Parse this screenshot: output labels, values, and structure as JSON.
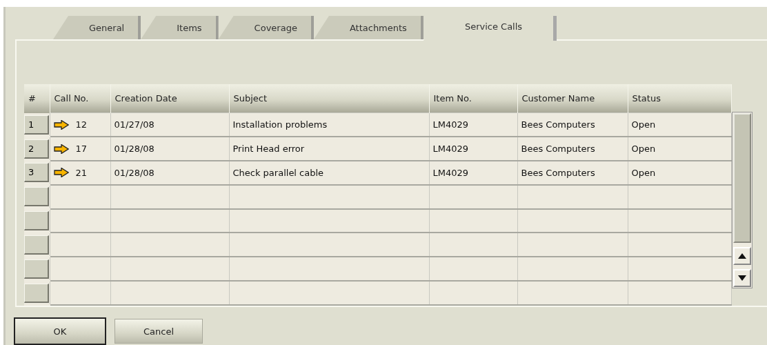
{
  "tabs": [
    {
      "label": "General",
      "selected": false
    },
    {
      "label": "Items",
      "selected": false
    },
    {
      "label": "Coverage",
      "selected": false
    },
    {
      "label": "Attachments",
      "selected": false
    },
    {
      "label": "Service Calls",
      "selected": true
    }
  ],
  "table": {
    "columns": [
      "#",
      "Call No.",
      "Creation Date",
      "Subject",
      "Item No.",
      "Customer Name",
      "Status"
    ],
    "rows": [
      {
        "number": "1",
        "call_no": "12",
        "creation_date": "01/27/08",
        "subject": "Installation problems",
        "item_no": "LM4029",
        "customer_name": "Bees Computers",
        "status": "Open"
      },
      {
        "number": "2",
        "call_no": "17",
        "creation_date": "01/28/08",
        "subject": "Print Head error",
        "item_no": "LM4029",
        "customer_name": "Bees Computers",
        "status": "Open"
      },
      {
        "number": "3",
        "call_no": "21",
        "creation_date": "01/28/08",
        "subject": "Check parallel cable",
        "item_no": "LM4029",
        "customer_name": "Bees Computers",
        "status": "Open"
      }
    ]
  },
  "buttons": [
    {
      "label": "OK",
      "default": true
    },
    {
      "label": "Cancel",
      "default": false
    }
  ]
}
